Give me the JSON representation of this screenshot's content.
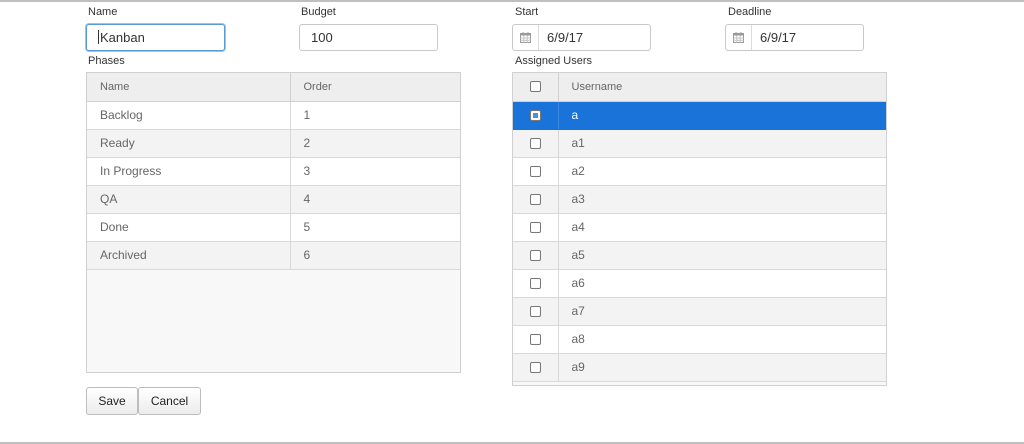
{
  "form": {
    "name_label": "Name",
    "name_value": "Kanban",
    "budget_label": "Budget",
    "budget_value": "100",
    "start_label": "Start",
    "start_value": "6/9/17",
    "deadline_label": "Deadline",
    "deadline_value": "6/9/17"
  },
  "phases": {
    "label": "Phases",
    "columns": [
      "Name",
      "Order"
    ],
    "rows": [
      {
        "name": "Backlog",
        "order": "1"
      },
      {
        "name": "Ready",
        "order": "2"
      },
      {
        "name": "In Progress",
        "order": "3"
      },
      {
        "name": "QA",
        "order": "4"
      },
      {
        "name": "Done",
        "order": "5"
      },
      {
        "name": "Archived",
        "order": "6"
      }
    ]
  },
  "users": {
    "label": "Assigned Users",
    "column": "Username",
    "rows": [
      {
        "username": "a",
        "checked": true,
        "selected": true
      },
      {
        "username": "a1",
        "checked": false,
        "selected": false
      },
      {
        "username": "a2",
        "checked": false,
        "selected": false
      },
      {
        "username": "a3",
        "checked": false,
        "selected": false
      },
      {
        "username": "a4",
        "checked": false,
        "selected": false
      },
      {
        "username": "a5",
        "checked": false,
        "selected": false
      },
      {
        "username": "a6",
        "checked": false,
        "selected": false
      },
      {
        "username": "a7",
        "checked": false,
        "selected": false
      },
      {
        "username": "a8",
        "checked": false,
        "selected": false
      },
      {
        "username": "a9",
        "checked": false,
        "selected": false
      }
    ]
  },
  "actions": {
    "save_label": "Save",
    "cancel_label": "Cancel"
  },
  "colors": {
    "selection": "#1a73d8",
    "focus_border": "#5b9bd5"
  },
  "icons": {
    "date_picker": "calendar-icon",
    "checkbox": "checkbox-icon"
  }
}
